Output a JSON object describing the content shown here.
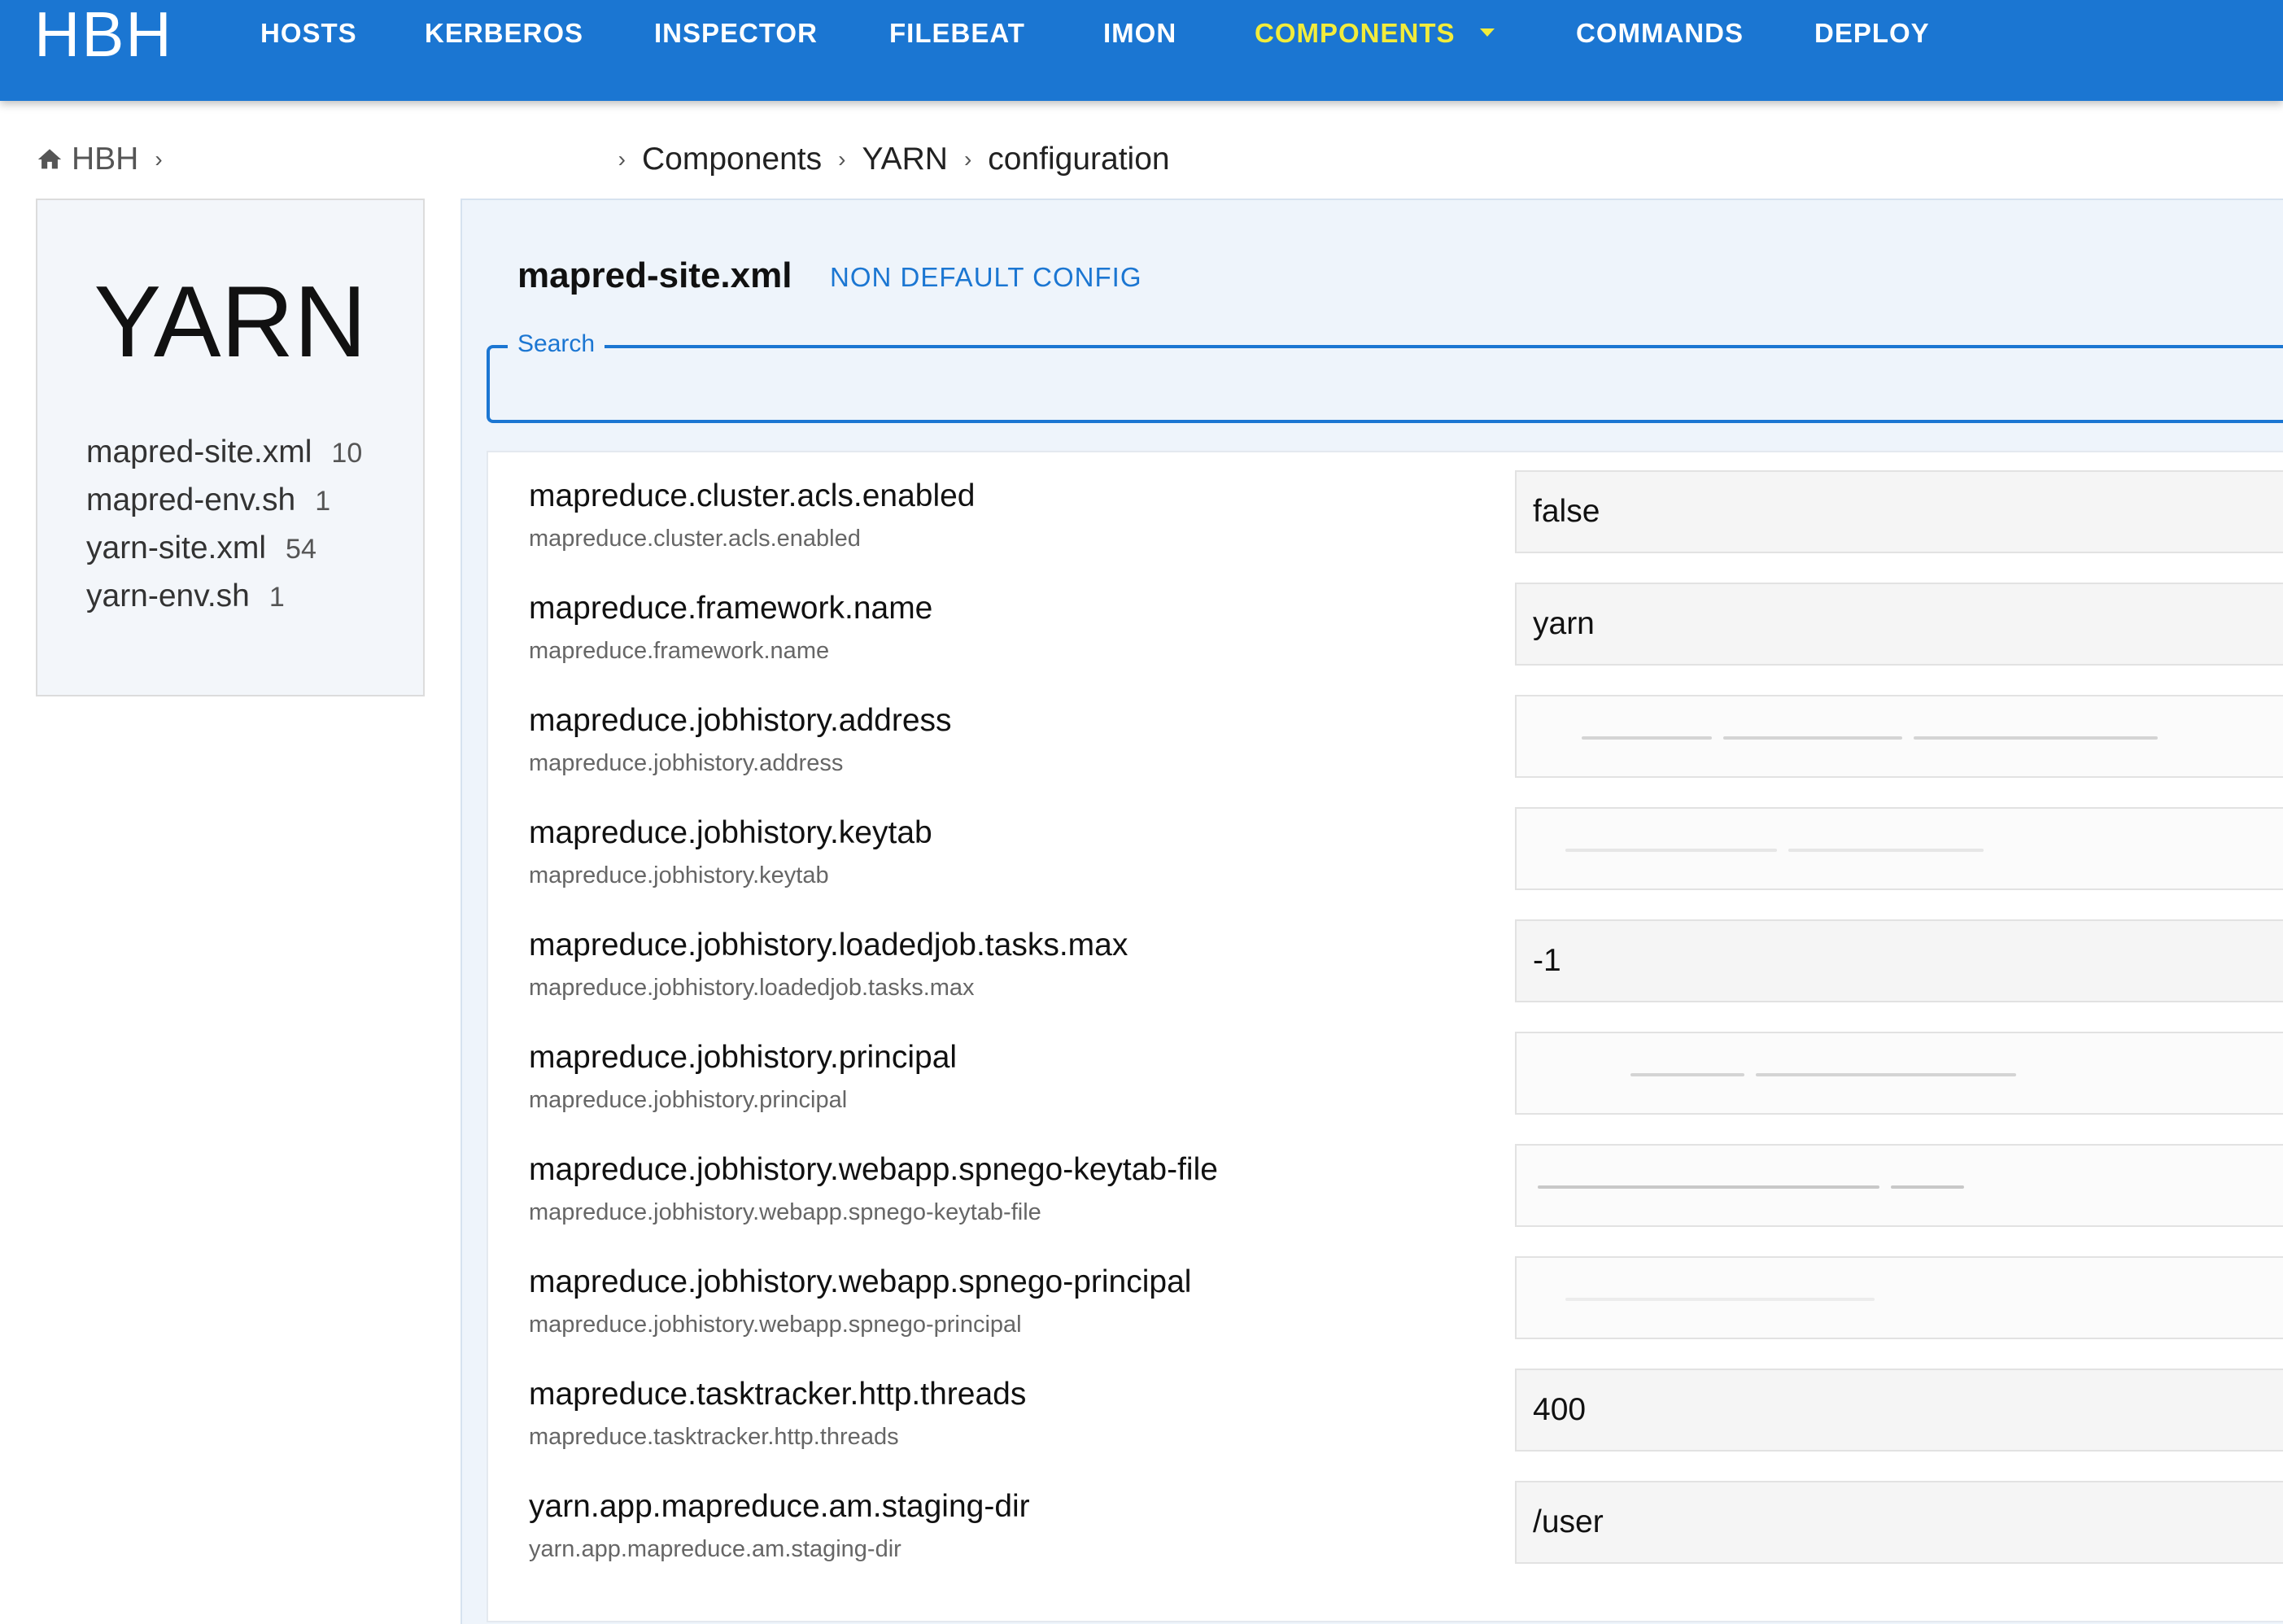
{
  "header": {
    "brand": "HBH",
    "nav": [
      {
        "label": "HOSTS",
        "active": false
      },
      {
        "label": "KERBEROS",
        "active": false
      },
      {
        "label": "INSPECTOR",
        "active": false
      },
      {
        "label": "FILEBEAT",
        "active": false
      },
      {
        "label": "IMON",
        "active": false
      },
      {
        "label": "COMPONENTS",
        "active": true,
        "dropdown": true
      },
      {
        "label": "COMMANDS",
        "active": false
      },
      {
        "label": "DEPLOY",
        "active": false
      }
    ],
    "colors": {
      "bar": "#1b76d2",
      "active": "#f2ec3b"
    }
  },
  "breadcrumb": {
    "home_icon": "home-icon",
    "items": [
      "HBH",
      "Components",
      "YARN",
      "configuration"
    ]
  },
  "sidebar": {
    "title": "YARN",
    "files": [
      {
        "name": "mapred-site.xml",
        "count": "10"
      },
      {
        "name": "mapred-env.sh",
        "count": "1"
      },
      {
        "name": "yarn-site.xml",
        "count": "54"
      },
      {
        "name": "yarn-env.sh",
        "count": "1"
      }
    ]
  },
  "main": {
    "file_title": "mapred-site.xml",
    "filter_link": "NON DEFAULT CONFIG",
    "search": {
      "label": "Search",
      "value": ""
    },
    "configs": [
      {
        "name": "mapreduce.cluster.acls.enabled",
        "key": "mapreduce.cluster.acls.enabled",
        "value": "false",
        "redacted": false
      },
      {
        "name": "mapreduce.framework.name",
        "key": "mapreduce.framework.name",
        "value": "yarn",
        "redacted": false
      },
      {
        "name": "mapreduce.jobhistory.address",
        "key": "mapreduce.jobhistory.address",
        "value": "",
        "redacted": true
      },
      {
        "name": "mapreduce.jobhistory.keytab",
        "key": "mapreduce.jobhistory.keytab",
        "value": "",
        "redacted": true
      },
      {
        "name": "mapreduce.jobhistory.loadedjob.tasks.max",
        "key": "mapreduce.jobhistory.loadedjob.tasks.max",
        "value": "-1",
        "redacted": false
      },
      {
        "name": "mapreduce.jobhistory.principal",
        "key": "mapreduce.jobhistory.principal",
        "value": "",
        "redacted": true
      },
      {
        "name": "mapreduce.jobhistory.webapp.spnego-keytab-file",
        "key": "mapreduce.jobhistory.webapp.spnego-keytab-file",
        "value": "",
        "redacted": true
      },
      {
        "name": "mapreduce.jobhistory.webapp.spnego-principal",
        "key": "mapreduce.jobhistory.webapp.spnego-principal",
        "value": "",
        "redacted": true
      },
      {
        "name": "mapreduce.tasktracker.http.threads",
        "key": "mapreduce.tasktracker.http.threads",
        "value": "400",
        "redacted": false
      },
      {
        "name": "yarn.app.mapreduce.am.staging-dir",
        "key": "yarn.app.mapreduce.am.staging-dir",
        "value": "/user",
        "redacted": false
      }
    ]
  }
}
